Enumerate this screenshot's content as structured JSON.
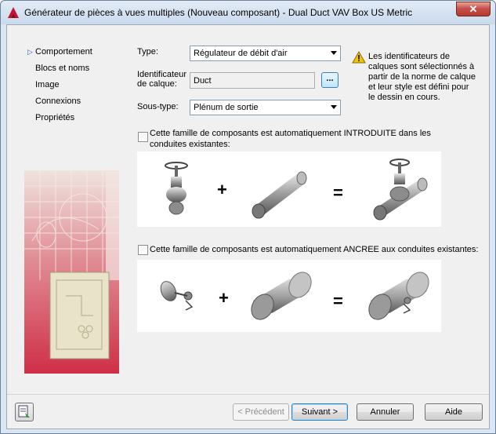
{
  "window": {
    "title": "Générateur de pièces à vues multiples (Nouveau composant) - Dual Duct VAV Box US Metric",
    "close_glyph": "✕",
    "app_icon": "autocad-logo-icon"
  },
  "nav": {
    "items": [
      {
        "label": "Comportement",
        "active": true
      },
      {
        "label": "Blocs et noms"
      },
      {
        "label": "Image"
      },
      {
        "label": "Connexions"
      },
      {
        "label": "Propriétés"
      }
    ]
  },
  "form": {
    "type_label": "Type:",
    "type_value": "Régulateur de débit d'air",
    "layer_label_1": "Identificateur",
    "layer_label_2": "de calque:",
    "layer_value": "Duct",
    "browse_label": "...",
    "subtype_label": "Sous-type:",
    "subtype_value": "Plénum de sortie",
    "info_text": "Les identificateurs de calques sont sélectionnés à partir de la norme de calque et leur style est défini pour le dessin en cours."
  },
  "insert_option": {
    "label": "Cette famille de composants est automatiquement INTRODUITE dans les conduites existantes:",
    "checked": false,
    "plus": "+",
    "equals": "="
  },
  "anchor_option": {
    "label": "Cette famille de composants est automatiquement ANCREE aux conduites existantes:",
    "checked": false,
    "plus": "+",
    "equals": "="
  },
  "buttons": {
    "back": "< Précédent",
    "next": "Suivant >",
    "cancel": "Annuler",
    "help": "Aide"
  },
  "colors": {
    "accent": "#1f5fbf",
    "art_red": "#d23a52"
  }
}
